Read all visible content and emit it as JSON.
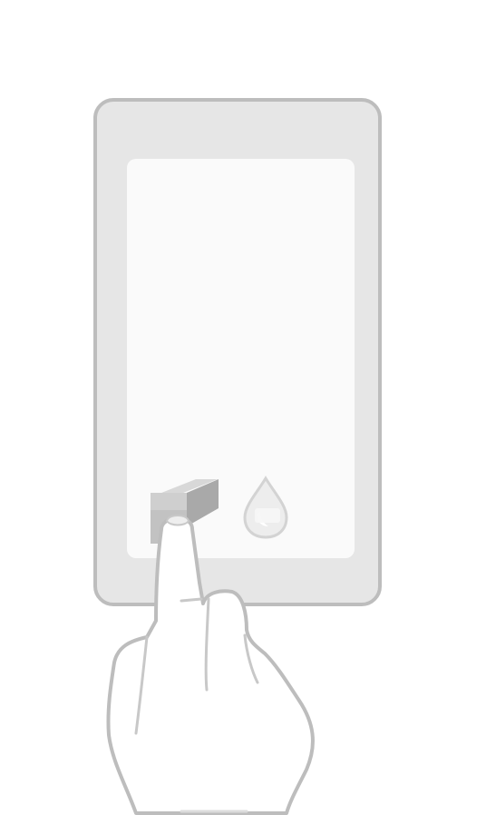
{
  "illustration": {
    "kind": "tap-gesture-instruction",
    "device": "tablet",
    "highlighted_icon": "eraser-icon",
    "secondary_icon": "water-drop-icon",
    "gesture": "single-finger-tap",
    "colors": {
      "background": "#ffffff",
      "device_frame_fill": "#e6e6e6",
      "device_frame_stroke": "#bdbdbd",
      "screen_fill": "#fafafa",
      "icon_gray": "#c2c2c2",
      "icon_dark": "#a9a9a9",
      "hand_fill": "#ffffff",
      "hand_stroke": "#bdbdbd"
    }
  }
}
